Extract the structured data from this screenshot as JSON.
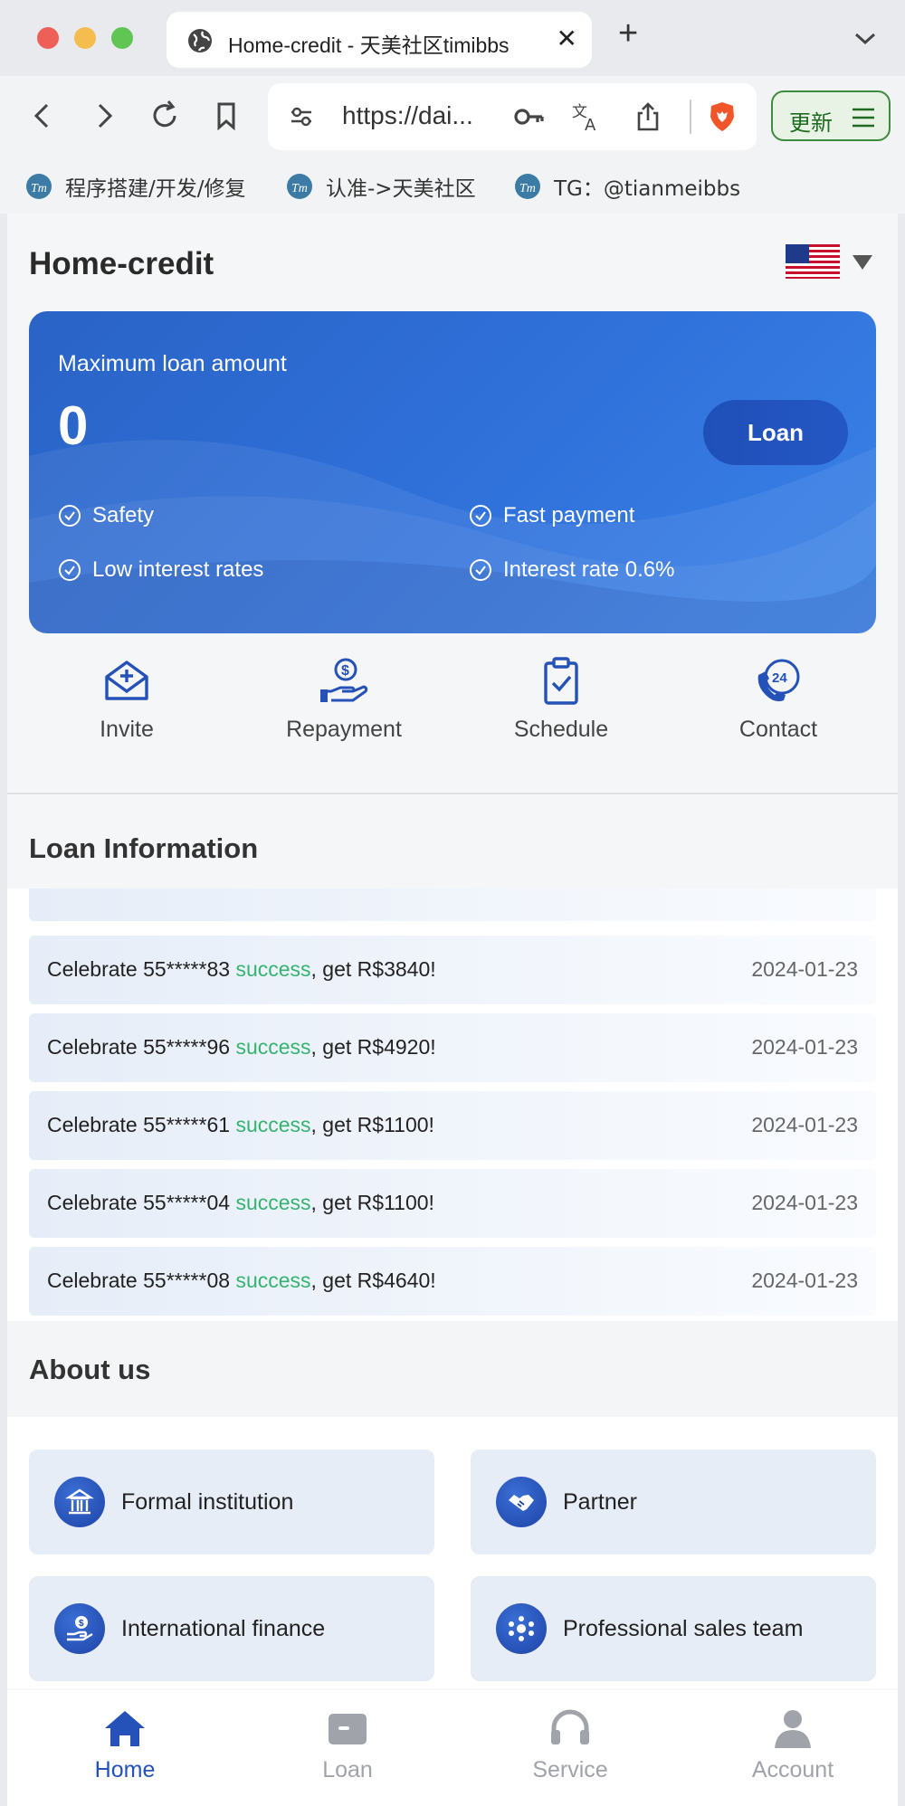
{
  "browser": {
    "tab_title": "Home-credit - 天美社区timibbs",
    "url": "https://dai...",
    "update_label": "更新",
    "bookmarks": [
      "程序搭建/开发/修复",
      "认准->天美社区",
      "TG：@tianmeibbs"
    ]
  },
  "header": {
    "brand": "Home-credit"
  },
  "hero": {
    "max_label": "Maximum loan amount",
    "amount": "0",
    "loan_button": "Loan",
    "features": [
      "Safety",
      "Fast payment",
      "Low interest rates",
      "Interest rate 0.6%"
    ]
  },
  "quick_actions": [
    "Invite",
    "Repayment",
    "Schedule",
    "Contact"
  ],
  "loan_info": {
    "title": "Loan Information",
    "items": [
      {
        "prefix": "Celebrate 55*****83 ",
        "status": "success",
        "suffix": ", get R$3840!",
        "date": "2024-01-23"
      },
      {
        "prefix": "Celebrate 55*****96 ",
        "status": "success",
        "suffix": ", get R$4920!",
        "date": "2024-01-23"
      },
      {
        "prefix": "Celebrate 55*****61 ",
        "status": "success",
        "suffix": ", get R$1100!",
        "date": "2024-01-23"
      },
      {
        "prefix": "Celebrate 55*****04 ",
        "status": "success",
        "suffix": ", get R$1100!",
        "date": "2024-01-23"
      },
      {
        "prefix": "Celebrate 55*****08 ",
        "status": "success",
        "suffix": ", get R$4640!",
        "date": "2024-01-23"
      }
    ]
  },
  "about": {
    "title": "About us",
    "cards": [
      "Formal institution",
      "Partner",
      "International finance",
      "Professional sales team"
    ]
  },
  "bottom_nav": [
    "Home",
    "Loan",
    "Service",
    "Account"
  ],
  "colors": {
    "primary": "#2452b8",
    "success": "#35b36f",
    "hero": "#2f70d9"
  }
}
